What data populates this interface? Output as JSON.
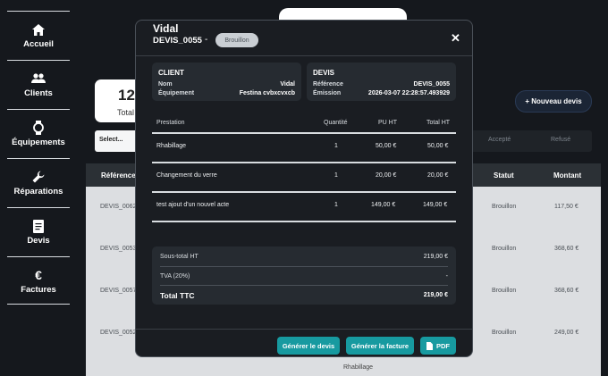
{
  "sidebar": {
    "items": [
      {
        "label": "Accueil",
        "icon": "home-icon"
      },
      {
        "label": "Clients",
        "icon": "users-icon"
      },
      {
        "label": "Équipements",
        "icon": "watch-icon"
      },
      {
        "label": "Réparations",
        "icon": "wrench-icon"
      },
      {
        "label": "Devis",
        "icon": "document-icon"
      },
      {
        "label": "Factures",
        "icon": "euro-icon"
      }
    ]
  },
  "background": {
    "stat_number": "12",
    "stat_caption": "Total",
    "new_quote_button": "+ Nouveau devis",
    "filter_select": "Select...",
    "filter_chips": [
      "Accepté",
      "Refusé"
    ],
    "table_headers": {
      "reference": "Référence",
      "status": "Statut",
      "amount": "Montant"
    },
    "rows": [
      {
        "ref": "DEVIS_0062",
        "status": "Brouillon",
        "amount": "117,50 €"
      },
      {
        "ref": "DEVIS_0053",
        "status": "Brouillon",
        "amount": "368,60 €"
      },
      {
        "ref": "DEVIS_0057",
        "status": "Brouillon",
        "amount": "368,60 €"
      },
      {
        "ref": "DEVIS_0052",
        "status": "Brouillon",
        "amount": "249,00 €"
      }
    ],
    "footer_text": "Rhabillage"
  },
  "modal": {
    "title": "Vidal",
    "quote_id": "DEVIS_0055",
    "dash": "-",
    "status_badge": "Brouillon",
    "close_glyph": "✕",
    "client": {
      "heading": "CLIENT",
      "name_label": "Nom",
      "name_value": "Vidal",
      "equipment_label": "Équipement",
      "equipment_value": "Festina cvbxcvxcb"
    },
    "quote": {
      "heading": "DEVIS",
      "reference_label": "Référence",
      "reference_value": "DEVIS_0055",
      "emission_label": "Émission",
      "emission_value": "2026-03-07 22:28:57.493929"
    },
    "services": {
      "headers": {
        "service": "Prestation",
        "quantity": "Quantité",
        "unit_price": "PU HT",
        "total": "Total HT"
      },
      "rows": [
        {
          "service": "Rhabillage",
          "quantity": "1",
          "unit_price": "50,00 €",
          "total": "50,00 €"
        },
        {
          "service": "Changement du verre",
          "quantity": "1",
          "unit_price": "20,00 €",
          "total": "20,00 €"
        },
        {
          "service": "test ajout d'un nouvel acte",
          "quantity": "1",
          "unit_price": "149,00 €",
          "total": "149,00 €"
        }
      ]
    },
    "totals": {
      "subtotal_label": "Sous-total HT",
      "subtotal_value": "219,00 €",
      "vat_label": "TVA (20%)",
      "vat_value": "-",
      "total_label": "Total TTC",
      "total_value": "219,00 €"
    },
    "buttons": {
      "generate_quote": "Générer le devis",
      "generate_invoice": "Générer la facture",
      "pdf": "PDF"
    }
  },
  "colors": {
    "background": "#15181d",
    "modal_bg": "#1a1d22",
    "card_bg": "#262b31",
    "accent_teal": "#179aa0",
    "badge_bg": "#c9ced3"
  }
}
